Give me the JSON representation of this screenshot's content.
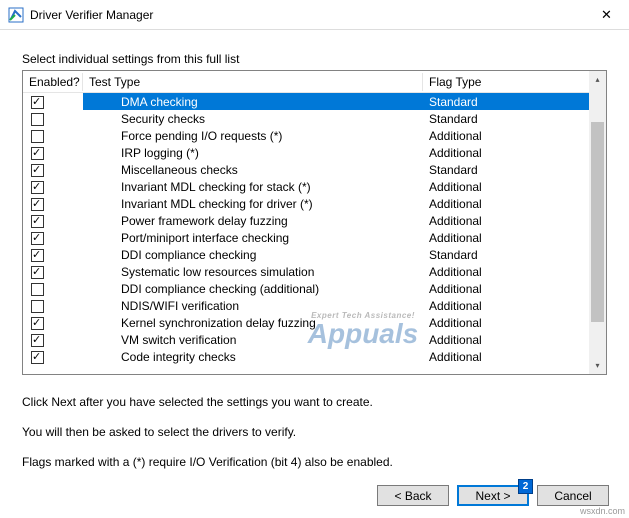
{
  "window": {
    "title": "Driver Verifier Manager",
    "close_glyph": "✕"
  },
  "instruction": "Select individual settings from this full list",
  "columns": {
    "enabled": "Enabled?",
    "test": "Test Type",
    "flag": "Flag Type"
  },
  "rows": [
    {
      "checked": true,
      "name": "DMA checking",
      "flag": "Standard",
      "selected": true
    },
    {
      "checked": false,
      "name": "Security checks",
      "flag": "Standard"
    },
    {
      "checked": false,
      "name": "Force pending I/O requests (*)",
      "flag": "Additional"
    },
    {
      "checked": true,
      "name": "IRP logging (*)",
      "flag": "Additional"
    },
    {
      "checked": true,
      "name": "Miscellaneous checks",
      "flag": "Standard"
    },
    {
      "checked": true,
      "name": "Invariant MDL checking for stack (*)",
      "flag": "Additional"
    },
    {
      "checked": true,
      "name": "Invariant MDL checking for driver (*)",
      "flag": "Additional"
    },
    {
      "checked": true,
      "name": "Power framework delay fuzzing",
      "flag": "Additional"
    },
    {
      "checked": true,
      "name": "Port/miniport interface checking",
      "flag": "Additional"
    },
    {
      "checked": true,
      "name": "DDI compliance checking",
      "flag": "Standard"
    },
    {
      "checked": true,
      "name": "Systematic low resources simulation",
      "flag": "Additional"
    },
    {
      "checked": false,
      "name": "DDI compliance checking (additional)",
      "flag": "Additional"
    },
    {
      "checked": false,
      "name": "NDIS/WIFI verification",
      "flag": "Additional"
    },
    {
      "checked": true,
      "name": "Kernel synchronization delay fuzzing",
      "flag": "Additional"
    },
    {
      "checked": true,
      "name": "VM switch verification",
      "flag": "Additional"
    },
    {
      "checked": true,
      "name": "Code integrity checks",
      "flag": "Additional"
    }
  ],
  "help": {
    "line1": "Click Next after you have selected the settings you want to create.",
    "line2": "You will then be asked to select the drivers to verify.",
    "line3": "Flags marked with a (*) require I/O Verification (bit 4) also be enabled."
  },
  "buttons": {
    "back": "< Back",
    "next": "Next >",
    "cancel": "Cancel"
  },
  "annotation_badge": "2",
  "scrollbar": {
    "up": "▴",
    "down": "▾"
  },
  "watermark": {
    "top": "Expert Tech Assistance!",
    "main": "Appuals"
  },
  "source": "wsxdn.com"
}
